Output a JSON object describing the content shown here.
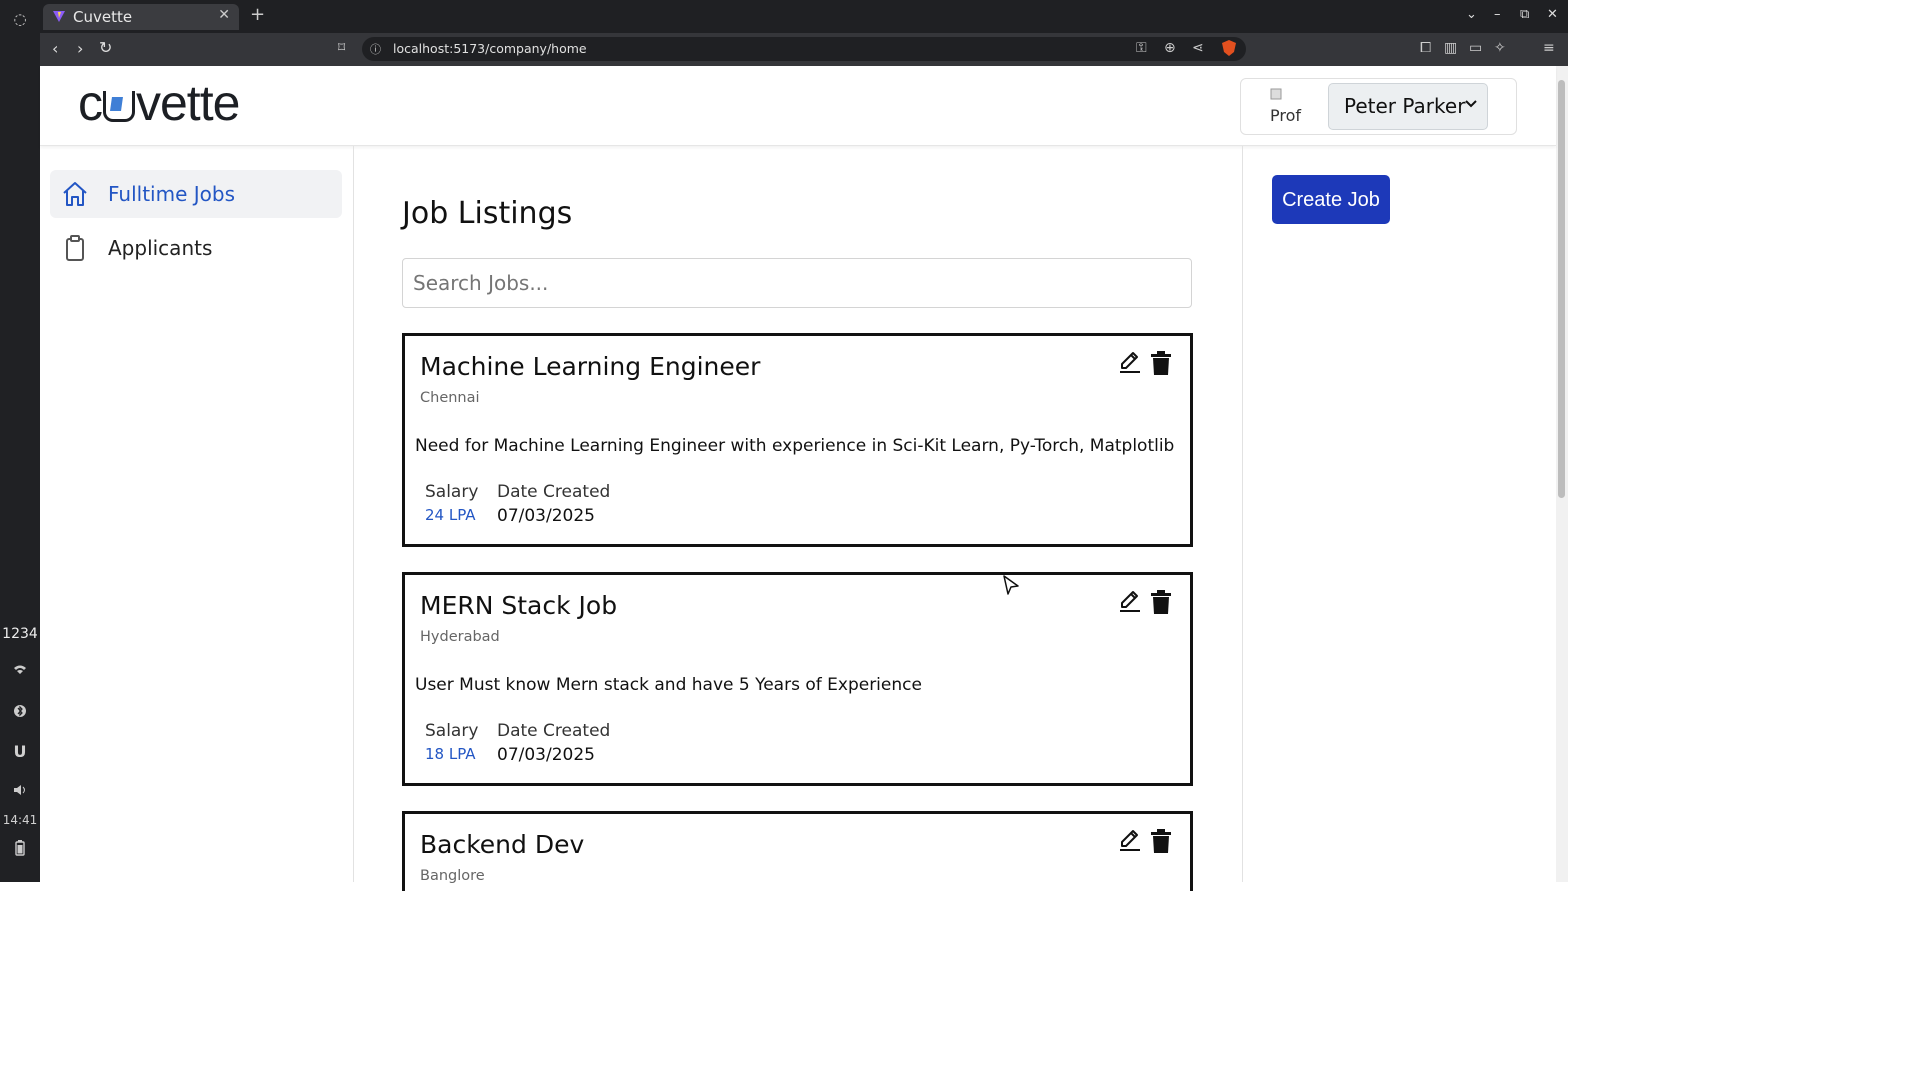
{
  "os": {
    "workspaces": "1234",
    "clock": "14:41"
  },
  "browser": {
    "tab_title": "Cuvette",
    "url": "localhost:5173/company/home"
  },
  "header": {
    "logo": "cuvette",
    "avatar_alt": "Prof",
    "user_name": "Peter Parker"
  },
  "sidebar": {
    "items": [
      {
        "label": "Fulltime Jobs",
        "icon": "home-icon",
        "active": true
      },
      {
        "label": "Applicants",
        "icon": "clipboard-icon",
        "active": false
      }
    ]
  },
  "main": {
    "title": "Job Listings",
    "search_placeholder": "Search Jobs...",
    "salary_label": "Salary",
    "date_label": "Date Created",
    "jobs": [
      {
        "title": "Machine Learning Engineer",
        "location": "Chennai",
        "description": "Need for Machine Learning Engineer with experience in Sci-Kit Learn, Py-Torch, Matplotlib",
        "salary": "24 LPA",
        "date": "07/03/2025"
      },
      {
        "title": "MERN Stack Job",
        "location": "Hyderabad",
        "description": "User Must know Mern stack and have 5 Years of Experience",
        "salary": "18 LPA",
        "date": "07/03/2025"
      },
      {
        "title": "Backend Dev",
        "location": "Banglore",
        "description": "",
        "salary": "",
        "date": ""
      }
    ]
  },
  "actions": {
    "create_job": "Create Job"
  },
  "colors": {
    "accent": "#1d39b9",
    "link": "#2356c4"
  }
}
